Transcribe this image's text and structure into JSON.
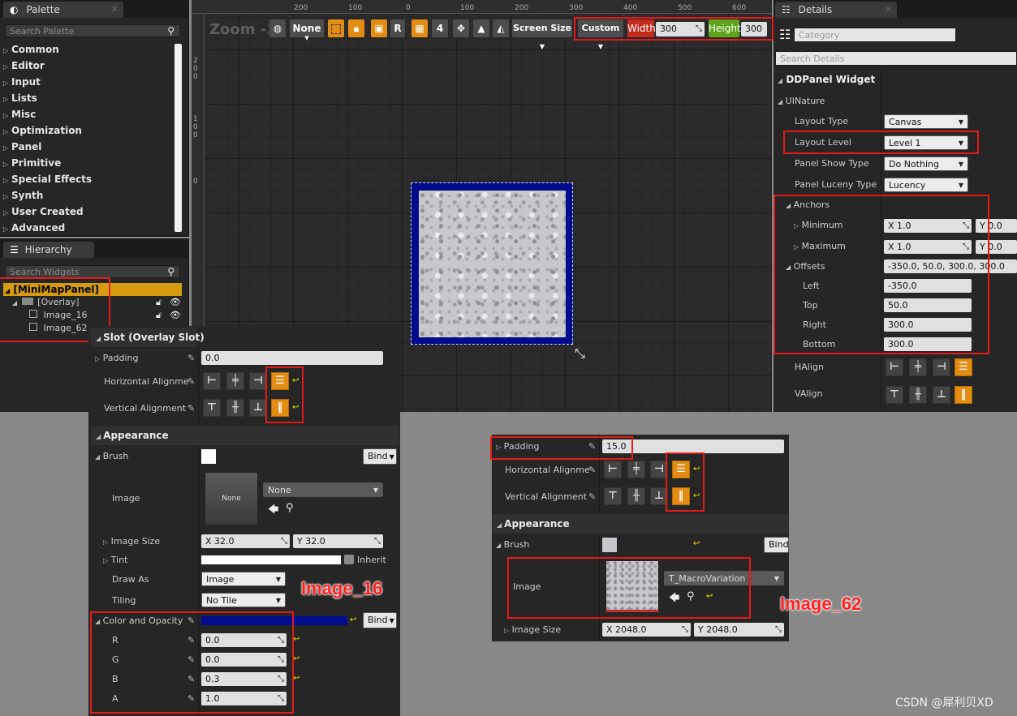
{
  "palette": {
    "tab": "Palette",
    "search_placeholder": "Search Palette",
    "categories": [
      "Common",
      "Editor",
      "Input",
      "Lists",
      "Misc",
      "Optimization",
      "Panel",
      "Primitive",
      "Special Effects",
      "Synth",
      "User Created",
      "Advanced"
    ]
  },
  "hierarchy": {
    "tab": "Hierarchy",
    "search_placeholder": "Search Widgets",
    "root": "[MiniMapPanel]",
    "overlay": "[Overlay]",
    "image1": "Image_16",
    "image2": "Image_62"
  },
  "viewport": {
    "zoom": "Zoom -3",
    "none_label": "None",
    "r_label": "R",
    "grid_num": "4",
    "screen_size": "Screen Size",
    "custom": "Custom",
    "width_label": "Width",
    "width_value": "300",
    "height_label": "Height",
    "height_value": "300",
    "ruler_top": [
      "200",
      "100",
      "0",
      "100",
      "200",
      "300",
      "400",
      "500",
      "600"
    ],
    "ruler_left": [
      "200",
      "100",
      "0"
    ]
  },
  "details": {
    "tab": "Details",
    "category_placeholder": "Category",
    "search_placeholder": "Search Details",
    "widget_name": "DDPanel Widget",
    "section_uinature": "UINature",
    "layout_type_label": "Layout Type",
    "layout_type": "Canvas",
    "layout_level_label": "Layout Level",
    "layout_level": "Level 1",
    "show_type_label": "Panel Show Type",
    "show_type": "Do Nothing",
    "lucency_label": "Panel Luceny Type",
    "lucency": "Lucency",
    "anchors": "Anchors",
    "minimum": "Minimum",
    "maximum": "Maximum",
    "min_x": "X  1.0",
    "min_y": "Y  0.0",
    "max_x": "X  1.0",
    "max_y": "Y  0.0",
    "offsets": "Offsets",
    "offsets_value": "-350.0, 50.0, 300.0, 300.0",
    "left": "Left",
    "left_value": "-350.0",
    "top": "Top",
    "top_value": "50.0",
    "right": "Right",
    "right_value": "300.0",
    "bottom": "Bottom",
    "bottom_value": "300.0",
    "halign": "HAlign",
    "valign": "VAlign"
  },
  "slot_panel": {
    "header": "Slot (Overlay Slot)",
    "padding_label": "Padding",
    "padding_value": "0.0",
    "halign_label": "Horizontal Alignme",
    "valign_label": "Vertical Alignment",
    "appearance": "Appearance",
    "brush": "Brush",
    "bind": "Bind",
    "image_label": "Image",
    "image_thumb": "None",
    "image_select": "None",
    "image_size_label": "Image Size",
    "size_x": "X  32.0",
    "size_y": "Y  32.0",
    "tint": "Tint",
    "inherit": "Inherit",
    "draw_as_label": "Draw As",
    "draw_as": "Image",
    "tiling_label": "Tiling",
    "tiling": "No Tile",
    "color_opacity": "Color and Opacity",
    "r_label": "R",
    "r_value": "0.0",
    "g_label": "G",
    "g_value": "0.0",
    "b_label": "B",
    "b_value": "0.3",
    "a_label": "A",
    "a_value": "1.0",
    "tint_color": "#000c8c"
  },
  "image62_panel": {
    "padding_label": "Padding",
    "padding_value": "15.0",
    "halign_label": "Horizontal Alignme",
    "valign_label": "Vertical Alignment",
    "appearance": "Appearance",
    "brush": "Brush",
    "bind": "Bind",
    "image_label": "Image",
    "image_select": "T_MacroVariation",
    "image_size_label": "Image Size",
    "size_x": "X  2048.0",
    "size_y": "Y  2048.0"
  },
  "annotations": {
    "image16": "Image_16",
    "image62": "Image_62"
  },
  "watermark": "CSDN @犀利贝XD",
  "colors": {
    "highlight_red": "#e41a1a",
    "accent_orange": "#e38c14",
    "width_red": "#c42b1c",
    "height_green": "#5ea41a",
    "selection_gold": "#d79b12",
    "frame_blue": "#000c8c"
  }
}
